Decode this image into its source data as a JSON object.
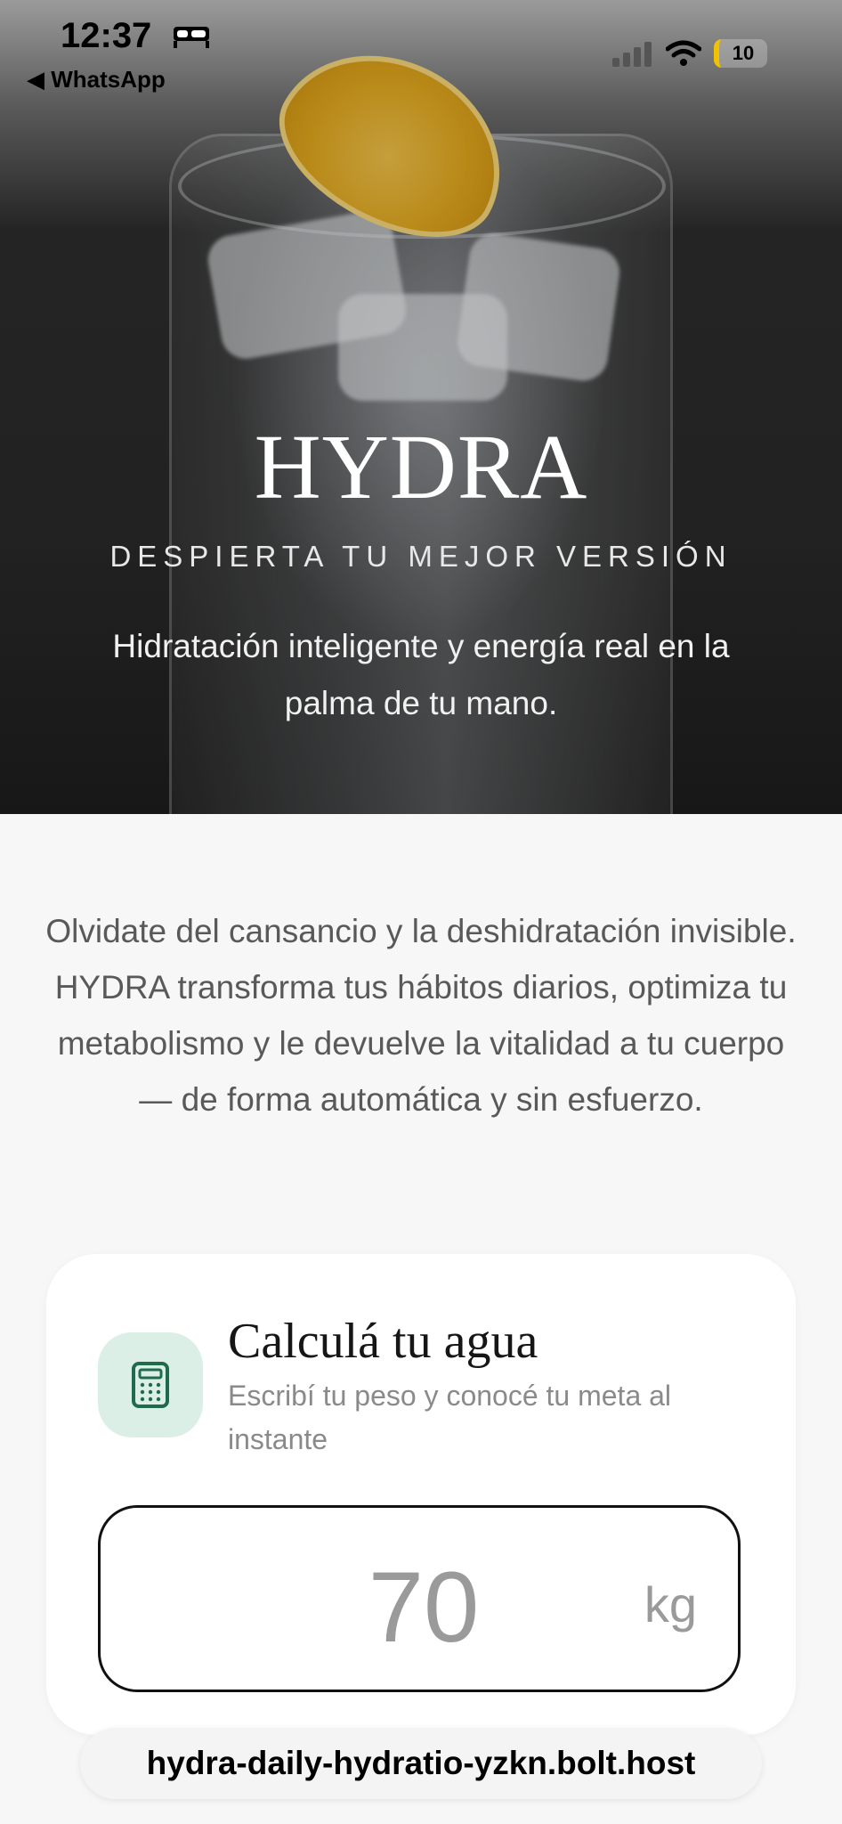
{
  "status_bar": {
    "time": "12:37",
    "back_label": "◀ WhatsApp",
    "battery": "10",
    "icons": [
      "bed-icon",
      "signal-icon",
      "wifi-icon",
      "battery-icon"
    ]
  },
  "hero": {
    "brand": "HYDRA",
    "tagline": "DESPIERTA TU MEJOR VERSIÓN",
    "description": "Hidratación inteligente y energía real en la palma de tu mano."
  },
  "intro": {
    "text": "Olvidate del cansancio y la deshidratación invisible. HYDRA transforma tus hábitos diarios, optimiza tu metabolismo y le devuelve la vitalidad a tu cuerpo — de forma automática y sin esfuerzo."
  },
  "calculator": {
    "icon": "calculator-icon",
    "title": "Calculá tu agua",
    "subtitle": "Escribí tu peso y conocé tu meta al instante",
    "weight_placeholder": "70",
    "unit": "kg"
  },
  "browser": {
    "url": "hydra-daily-hydratio-yzkn.bolt.host"
  },
  "colors": {
    "accent_green": "#1f6b4c",
    "badge_bg": "#dcefe6",
    "battery_yellow": "#f2c200"
  }
}
